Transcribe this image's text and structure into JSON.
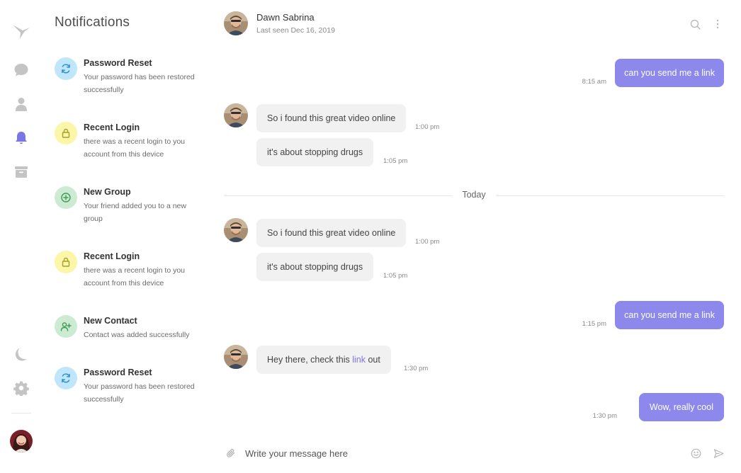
{
  "nav": {
    "icons": [
      "hummingbird-logo-icon",
      "chat-bubble-icon",
      "user-icon",
      "bell-icon",
      "archive-icon",
      "moon-icon",
      "gear-icon"
    ],
    "active": "notifications",
    "accent": "#7b76e6",
    "icon_color": "#c4c4c4"
  },
  "notifications": {
    "title": "Notifications",
    "items": [
      {
        "title": "Password Reset",
        "desc": "Your password has been restored successfully",
        "icon": "refresh-icon",
        "bg": "#bfe6fb",
        "fg": "#2b8fce"
      },
      {
        "title": "Recent Login",
        "desc": "there was a recent login to you account from this device",
        "icon": "lock-icon",
        "bg": "#fbf6a8",
        "fg": "#a89f2a"
      },
      {
        "title": "New Group",
        "desc": "Your friend added you to a new group",
        "icon": "plus-circle-icon",
        "bg": "#cdebd2",
        "fg": "#3f9a55"
      },
      {
        "title": "Recent Login",
        "desc": "there was a recent login to you account from this device",
        "icon": "lock-icon",
        "bg": "#fbf6a8",
        "fg": "#a89f2a"
      },
      {
        "title": "New Contact",
        "desc": "Contact was added successfully",
        "icon": "user-plus-icon",
        "bg": "#cdebd2",
        "fg": "#3f9a55"
      },
      {
        "title": "Password Reset",
        "desc": "Your password has been restored successfully",
        "icon": "refresh-icon",
        "bg": "#bfe6fb",
        "fg": "#2b8fce"
      }
    ]
  },
  "chat": {
    "contact_name": "Dawn Sabrina",
    "status": "Last seen Dec 16, 2019",
    "outgoing_color": "#8c88ec",
    "incoming_color": "#f1f1f1",
    "messages": [
      {
        "dir": "out",
        "text": "can you send me a link",
        "time": "8:15 am"
      },
      {
        "dir": "in",
        "text": "So i found this great video online",
        "time": "1:00 pm"
      },
      {
        "dir": "in",
        "text": "it's about stopping drugs",
        "time": "1:05 pm"
      },
      {
        "dir": "in",
        "text": "So i found this great video online",
        "time": "1:00 pm"
      },
      {
        "dir": "in",
        "text": "it's about stopping drugs",
        "time": "1:05 pm"
      },
      {
        "dir": "out",
        "text": "can you send me a link",
        "time": "1:15 pm"
      },
      {
        "dir": "in",
        "text_before": "Hey there, check this ",
        "link": "link",
        "text_after": " out",
        "time": "1:30 pm"
      },
      {
        "dir": "out",
        "text": "Wow, really cool",
        "time": "1:30 pm"
      }
    ],
    "day_separator": "Today",
    "composer_placeholder": "Write your message here"
  }
}
